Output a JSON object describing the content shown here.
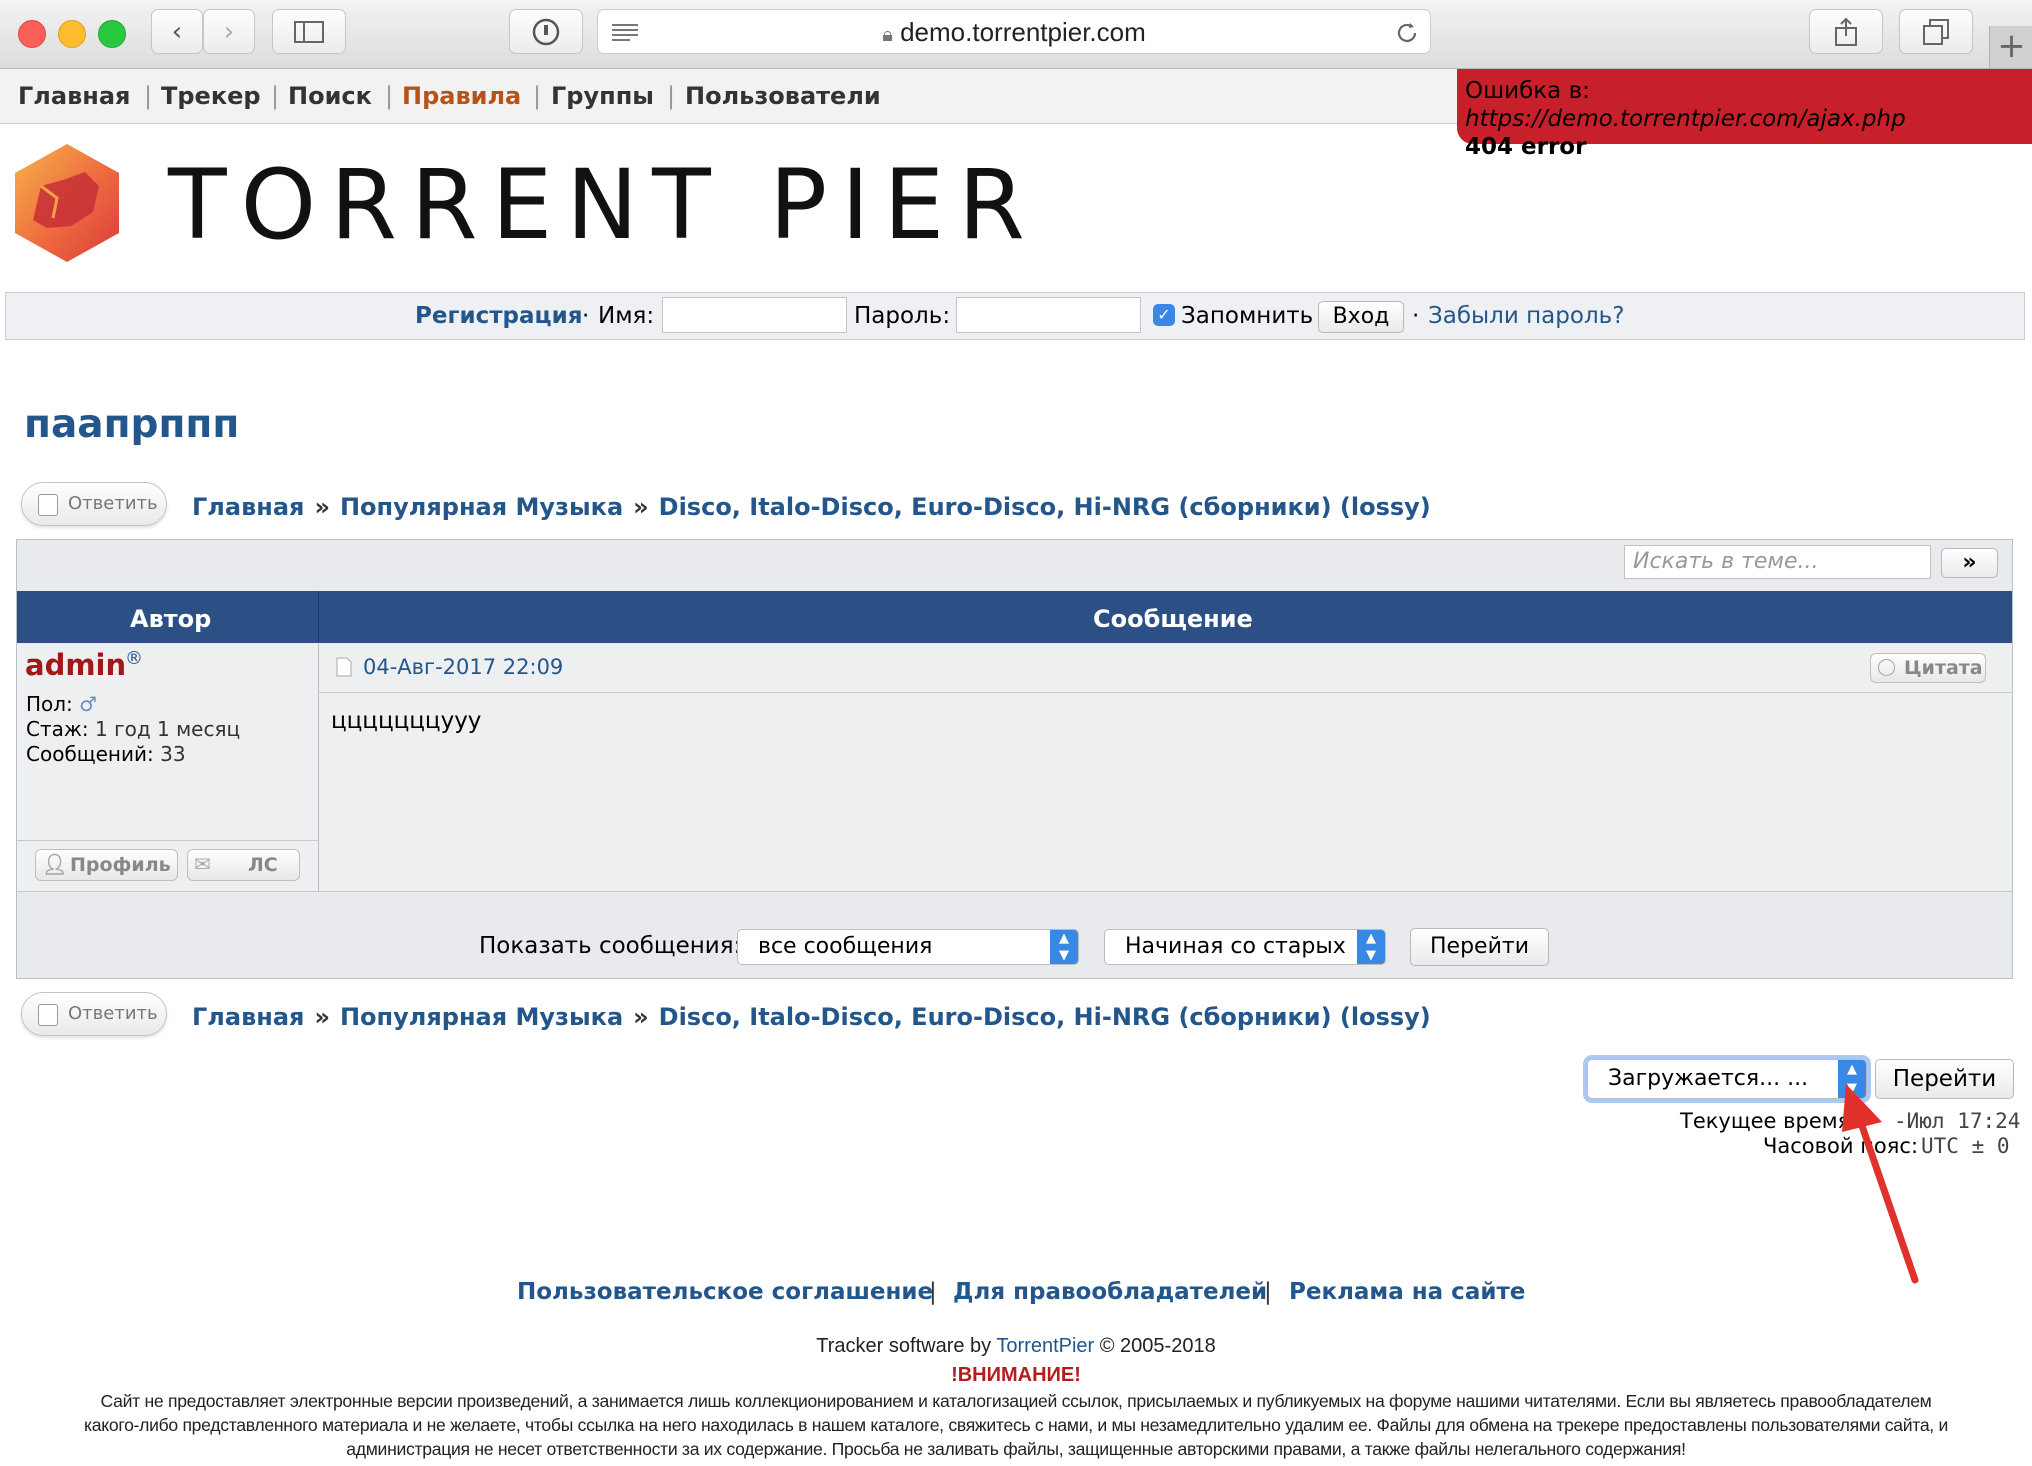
{
  "browser": {
    "url": "demo.torrentpier.com"
  },
  "nav": {
    "items": [
      "Главная",
      "Трекер",
      "Поиск",
      "Правила",
      "Группы",
      "Пользователи"
    ]
  },
  "error": {
    "prefix": "Ошибка в:",
    "url": "https://demo.torrentpier.com/ajax.php",
    "code": "404 error"
  },
  "logo": {
    "text": "TORRENT PIER"
  },
  "login": {
    "register": "Регистрация",
    "name_label": "Имя:",
    "password_label": "Пароль:",
    "remember_label": "Запомнить",
    "login_button": "Вход",
    "forgot": "Забыли пароль?"
  },
  "topic": {
    "title": "паапpппп",
    "reply_label": "Ответить",
    "breadcrumb": [
      "Главная",
      "Популярная Музыка",
      "Disco, Italo-Disco, Euro-Disco, Hi-NRG (сборники) (lossy)"
    ],
    "search_placeholder": "Искать в теме...",
    "search_button": "»",
    "col_author": "Автор",
    "col_message": "Сообщение"
  },
  "post": {
    "author": "admin",
    "reg_mark": "®",
    "gender_label": "Пол:",
    "tenure_label": "Стаж:",
    "tenure_value": "1 год 1 месяц",
    "posts_label": "Сообщений:",
    "posts_value": "33",
    "date": "04-Авг-2017 22:09",
    "quote_label": "Цитата",
    "body": "цццццццууу",
    "profile_label": "Профиль",
    "pm_label": "ЛС"
  },
  "sort": {
    "label": "Показать сообщения:",
    "filter_value": "все сообщения",
    "order_value": "Начиная со старых",
    "go_label": "Перейти"
  },
  "jump": {
    "select_value": "Загружается... ...",
    "go_label": "Перейти",
    "time_label": "Текущее время:",
    "time_value": "-Июл 17:24",
    "tz_label": "Часовой пояс:",
    "tz_value": "UTC ± 0"
  },
  "footer": {
    "links": [
      "Пользовательское соглашение",
      "Для правообладателей",
      "Реклама на сайте"
    ],
    "software_prefix": "Tracker software by",
    "software_link": "TorrentPier",
    "software_suffix": "© 2005-2018",
    "warning_title": "!ВНИМАНИЕ!",
    "disclaimer_1": "Сайт не предоставляет электронные версии произведений, а занимается лишь коллекционированием и каталогизацией ссылок, присылаемых и публикуемых на форуме нашими читателями. Если вы являетесь правообладателем",
    "disclaimer_2": "какого-либо представленного материала и не желаете, чтобы ссылка на него находилась в нашем каталоге, свяжитесь с нами, и мы незамедлительно удалим ее. Файлы для обмена на трекере предоставлены пользователями сайта, и",
    "disclaimer_3": "администрация не несет ответственности за их содержание. Просьба не заливать файлы, защищенные авторскими правами, а также файлы нелегального содержания!"
  },
  "colors": {
    "link": "#23568a",
    "header_bar": "#2c5085",
    "error_bg": "#c8202a",
    "author_name": "#a01818",
    "rules_link": "#b5541a",
    "annotation_arrow": "#e0312d"
  }
}
